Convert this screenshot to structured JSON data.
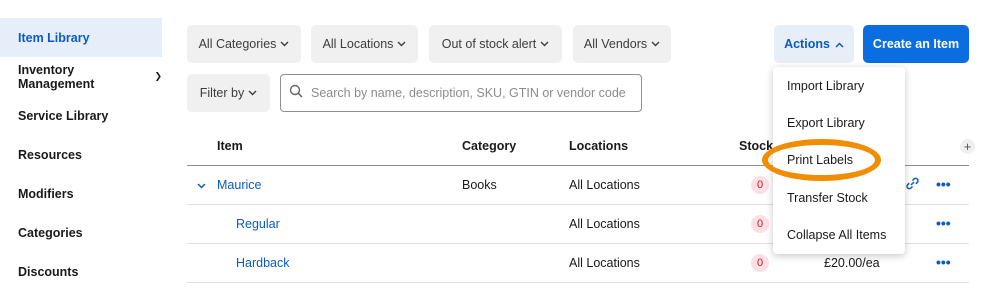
{
  "sidebar": {
    "items": [
      {
        "label": "Item Library",
        "active": true
      },
      {
        "label": "Inventory Management",
        "has_chevron": true
      },
      {
        "label": "Service Library"
      },
      {
        "label": "Resources"
      },
      {
        "label": "Modifiers"
      },
      {
        "label": "Categories"
      },
      {
        "label": "Discounts"
      }
    ]
  },
  "filters": {
    "all_categories": "All Categories",
    "all_locations": "All Locations",
    "out_of_stock_alert": "Out of stock alert",
    "all_vendors": "All Vendors",
    "filter_by": "Filter by"
  },
  "header": {
    "actions_label": "Actions",
    "create_label": "Create an Item"
  },
  "search": {
    "placeholder": "Search by name, description, SKU, GTIN or vendor code"
  },
  "table": {
    "columns": [
      "Item",
      "Category",
      "Locations",
      "Stock"
    ],
    "rows": [
      {
        "item": "Maurice",
        "category": "Books",
        "locations": "All Locations",
        "stock": "0",
        "price": ""
      },
      {
        "item": "Regular",
        "category": "",
        "locations": "All Locations",
        "stock": "0",
        "price": ""
      },
      {
        "item": "Hardback",
        "category": "",
        "locations": "All Locations",
        "stock": "0",
        "price": "£20.00/ea"
      }
    ]
  },
  "actions_menu": {
    "items": [
      "Import Library",
      "Export Library",
      "Print Labels",
      "Transfer Stock",
      "Collapse All Items"
    ]
  },
  "colors": {
    "accent": "#0a5cc2",
    "primary_button": "#0a6de0",
    "highlight_annotation": "#f28c00",
    "stock_badge_bg": "#fde0e3"
  }
}
